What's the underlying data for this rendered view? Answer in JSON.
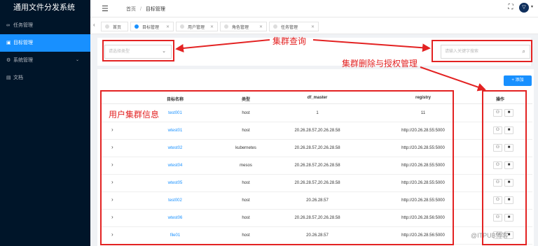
{
  "app": {
    "title": "通用文件分发系统"
  },
  "sidebar": {
    "items": [
      {
        "icon": "∞",
        "label": "任务管理",
        "active": false
      },
      {
        "icon": "▣",
        "label": "目标管理",
        "active": true
      },
      {
        "icon": "⚙",
        "label": "系统管理",
        "active": false,
        "has_children": true
      },
      {
        "icon": "▤",
        "label": "文档",
        "active": false
      }
    ]
  },
  "header": {
    "breadcrumb": [
      "首页",
      "目标管理"
    ]
  },
  "tabs": [
    {
      "label": "首页",
      "active": false,
      "closable": false
    },
    {
      "label": "目标管理",
      "active": true,
      "closable": true
    },
    {
      "label": "用户管理",
      "active": false,
      "closable": true
    },
    {
      "label": "角色管理",
      "active": false,
      "closable": true
    },
    {
      "label": "任务管理",
      "active": false,
      "closable": true
    }
  ],
  "filters": {
    "select_placeholder": "请选择类型",
    "search_placeholder": "请输入关键字搜索"
  },
  "toolbar": {
    "add_label": "+ 添加"
  },
  "table": {
    "columns": [
      "目标名称",
      "类型",
      "df_master",
      "registry",
      "操作"
    ],
    "rows": [
      {
        "name": "test001",
        "type": "host",
        "df_master": "1",
        "registry": "11",
        "expandable": false
      },
      {
        "name": "wtest01",
        "type": "host",
        "df_master": "20.26.28.57,20.26.28.58",
        "registry": "http://20.26.28.55:5000",
        "expandable": true
      },
      {
        "name": "wtest02",
        "type": "kubernetes",
        "df_master": "20.26.28.57,20.26.28.58",
        "registry": "http://20.26.28.55:5000",
        "expandable": true
      },
      {
        "name": "wtest04",
        "type": "mesos",
        "df_master": "20.26.28.57,20.26.28.58",
        "registry": "http://20.26.28.55:5000",
        "expandable": true
      },
      {
        "name": "wtest05",
        "type": "host",
        "df_master": "20.26.28.57,20.26.28.58",
        "registry": "http://20.26.28.55:5000",
        "expandable": true
      },
      {
        "name": "test002",
        "type": "host",
        "df_master": "20.26.28.57",
        "registry": "http://20.26.28.55:5000",
        "expandable": true
      },
      {
        "name": "wtest06",
        "type": "host",
        "df_master": "20.26.28.57,20.26.28.58",
        "registry": "http://20.26.28.56:5000",
        "expandable": true
      },
      {
        "name": "file01",
        "type": "host",
        "df_master": "20.26.28.57",
        "registry": "http://20.26.28.56:5000",
        "expandable": true
      }
    ]
  },
  "annotations": {
    "cluster_query": "集群查询",
    "cluster_delete_auth": "集群删除与授权管理",
    "user_cluster_info": "用户集群信息",
    "color": "#e32222"
  },
  "watermark": "@ITPUB博客",
  "colors": {
    "accent": "#1890ff",
    "sidebar_bg": "#001529"
  }
}
